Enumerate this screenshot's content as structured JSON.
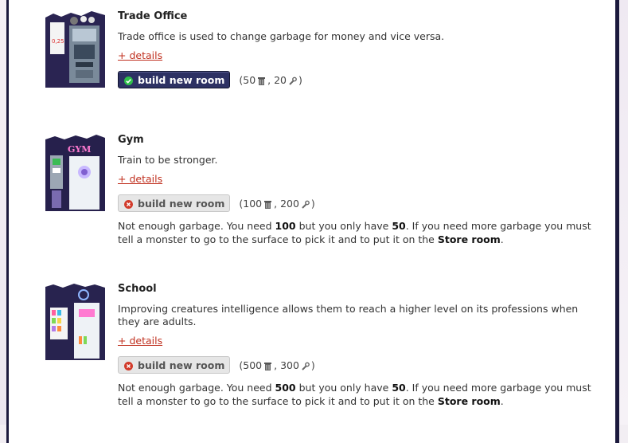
{
  "rooms": [
    {
      "title": "Trade Office",
      "description": "Trade office is used to change garbage for money and vice versa.",
      "details_label": "+ details",
      "button_label": "build new room",
      "button_state": "enabled",
      "cost_garbage": "50",
      "cost_other": "20",
      "warning": null,
      "thumb_text": "0,25"
    },
    {
      "title": "Gym",
      "description": "Train to be stronger.",
      "details_label": "+ details",
      "button_label": "build new room",
      "button_state": "disabled",
      "cost_garbage": "100",
      "cost_other": "200",
      "warning": {
        "part1": "Not enough garbage. You need ",
        "need": "100",
        "part2": " but you only have ",
        "have": "50",
        "part3": ". If you need more garbage you must tell a monster to go to the surface to pick it and to put it on the ",
        "room": "Store room",
        "part4": "."
      },
      "thumb_text": "GYM"
    },
    {
      "title": "School",
      "description": "Improving creatures intelligence allows them to reach a higher level on its professions when they are adults.",
      "details_label": "+ details",
      "button_label": "build new room",
      "button_state": "disabled",
      "cost_garbage": "500",
      "cost_other": "300",
      "warning": {
        "part1": "Not enough garbage. You need ",
        "need": "500",
        "part2": " but you only have ",
        "have": "50",
        "part3": ". If you need more garbage you must tell a monster to go to the surface to pick it and to put it on the ",
        "room": "Store room",
        "part4": "."
      },
      "thumb_text": ""
    }
  ],
  "colors": {
    "panel_border": "#1c1a3d",
    "button_enabled": "#2d3163",
    "button_disabled": "#e6e6e6",
    "details_link": "#c0301f",
    "check_green": "#2fbf4a",
    "cross_red": "#d23b2b"
  },
  "icons": {
    "garbage": "trash-bin-icon",
    "other_resource": "wrench-icon",
    "enabled": "check-icon",
    "disabled": "cross-icon"
  }
}
